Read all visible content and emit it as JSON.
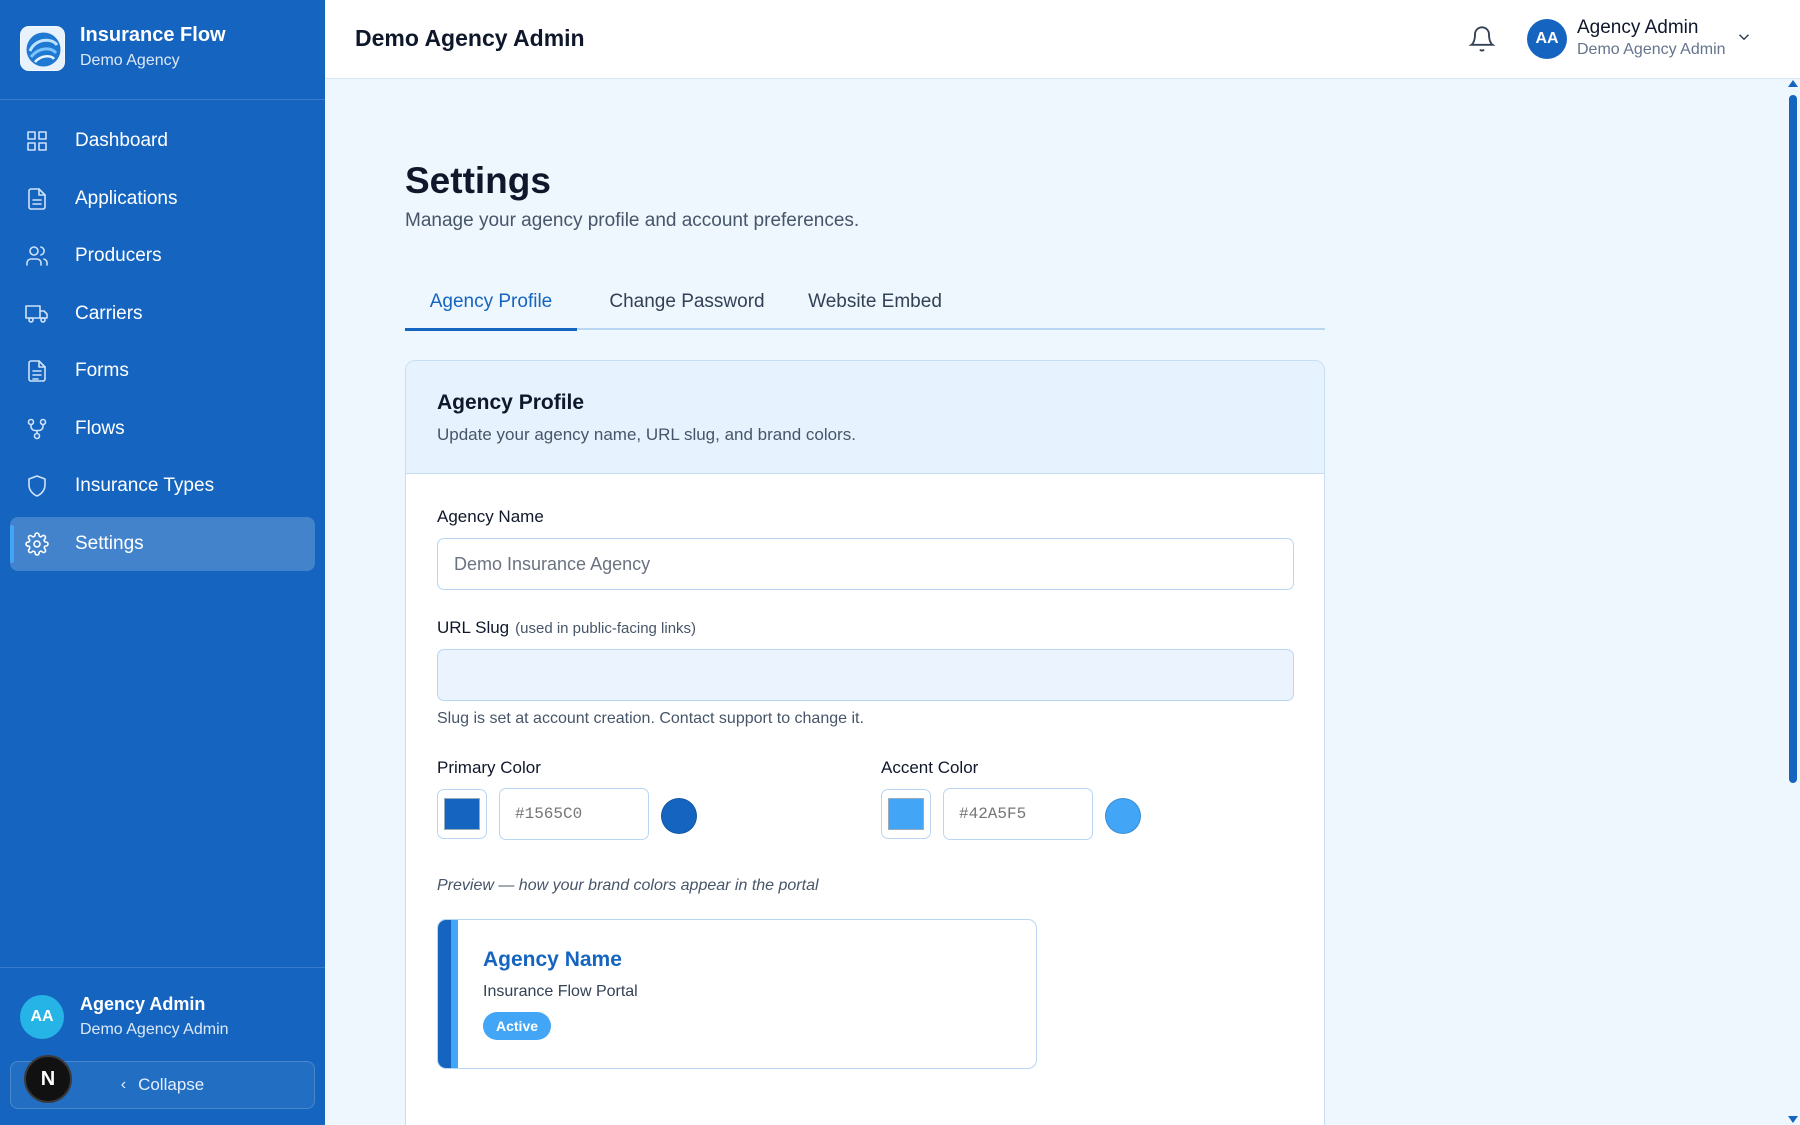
{
  "app": {
    "name": "Insurance Flow",
    "agency": "Demo Agency",
    "header_title": "Demo Agency Admin"
  },
  "sidebar": {
    "items": [
      {
        "label": "Dashboard",
        "icon": "grid-icon"
      },
      {
        "label": "Applications",
        "icon": "file-icon"
      },
      {
        "label": "Producers",
        "icon": "users-icon"
      },
      {
        "label": "Carriers",
        "icon": "truck-icon"
      },
      {
        "label": "Forms",
        "icon": "document-icon"
      },
      {
        "label": "Flows",
        "icon": "git-branch-icon"
      },
      {
        "label": "Insurance Types",
        "icon": "shield-icon"
      },
      {
        "label": "Settings",
        "icon": "gear-icon",
        "active": true
      }
    ],
    "user": {
      "initials": "AA",
      "name": "Agency Admin",
      "role": "Demo Agency Admin"
    },
    "collapse_label": "Collapse",
    "dev_badge": "N"
  },
  "header": {
    "user_initials": "AA",
    "user_name": "Agency Admin",
    "user_role": "Demo Agency Admin"
  },
  "page": {
    "title": "Settings",
    "subtitle": "Manage your agency profile and account preferences."
  },
  "tabs": [
    {
      "label": "Agency Profile",
      "active": true
    },
    {
      "label": "Change Password",
      "active": false
    },
    {
      "label": "Website Embed",
      "active": false
    }
  ],
  "profile": {
    "title": "Agency Profile",
    "description": "Update your agency name, URL slug, and brand colors.",
    "agency_name_label": "Agency Name",
    "agency_name_placeholder": "Demo Insurance Agency",
    "slug_label": "URL Slug",
    "slug_hint": "(used in public-facing links)",
    "slug_value": "",
    "slug_help": "Slug is set at account creation. Contact support to change it.",
    "primary_label": "Primary Color",
    "primary_value": "#1565C0",
    "accent_label": "Accent Color",
    "accent_value": "#42A5F5",
    "preview_label": "Preview — how your brand colors appear in the portal",
    "preview_name": "Agency Name",
    "preview_sub": "Insurance Flow Portal",
    "preview_badge": "Active"
  },
  "colors": {
    "primary": "#1565C0",
    "accent": "#42A5F5"
  }
}
